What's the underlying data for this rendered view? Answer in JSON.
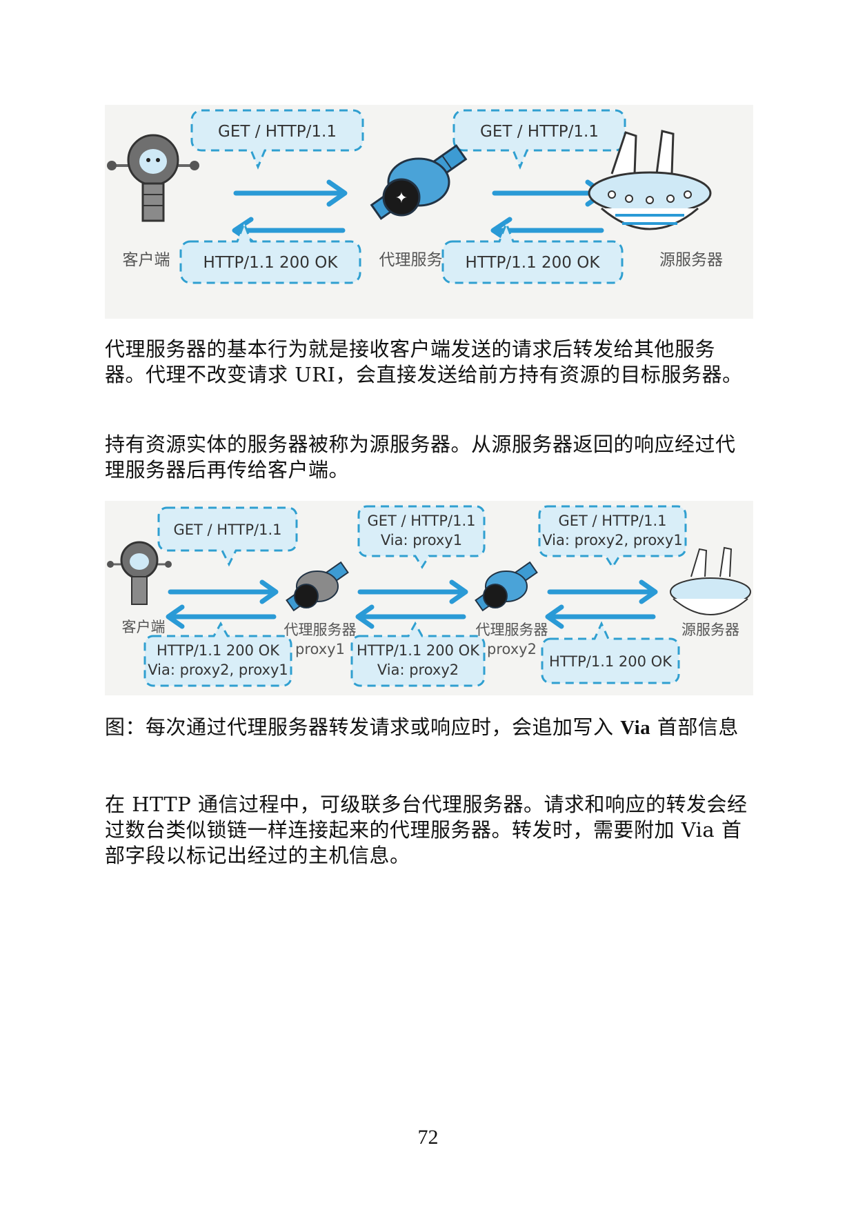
{
  "figure1": {
    "client_label": "客户端",
    "proxy_label": "代理服务器",
    "origin_label": "源服务器",
    "request_left": "GET / HTTP/1.1",
    "request_right": "GET / HTTP/1.1",
    "response_left": "HTTP/1.1 200 OK",
    "response_right": "HTTP/1.1 200 OK"
  },
  "paragraph1": "代理服务器的基本行为就是接收客户端发送的请求后转发给其他服务器。代理不改变请求 URI，会直接发送给前方持有资源的目标服务器。",
  "paragraph2": "持有资源实体的服务器被称为源服务器。从源服务器返回的响应经过代理服务器后再传给客户端。",
  "figure2": {
    "client_label": "客户端",
    "proxy1_label": "代理服务器",
    "proxy1_name": "proxy1",
    "proxy2_label": "代理服务器",
    "proxy2_name": "proxy2",
    "origin_label": "源服务器",
    "req1_line1": "GET / HTTP/1.1",
    "req2_line1": "GET / HTTP/1.1",
    "req2_line2": "Via: proxy1",
    "req3_line1": "GET / HTTP/1.1",
    "req3_line2": "Via: proxy2, proxy1",
    "res1_line1": "HTTP/1.1 200 OK",
    "res1_line2": "Via: proxy2, proxy1",
    "res2_line1": "HTTP/1.1 200 OK",
    "res2_line2": "Via: proxy2",
    "res3_line1": "HTTP/1.1 200 OK"
  },
  "caption": {
    "prefix": "图：每次通过代理服务器转发请求或响应时，会追加写入 ",
    "bold": "Via",
    "suffix": " 首部信息"
  },
  "paragraph3": "在 HTTP 通信过程中，可级联多台代理服务器。请求和响应的转发会经过数台类似锁链一样连接起来的代理服务器。转发时，需要附加 Via 首部字段以标记出经过的主机信息。",
  "page_number": "72"
}
